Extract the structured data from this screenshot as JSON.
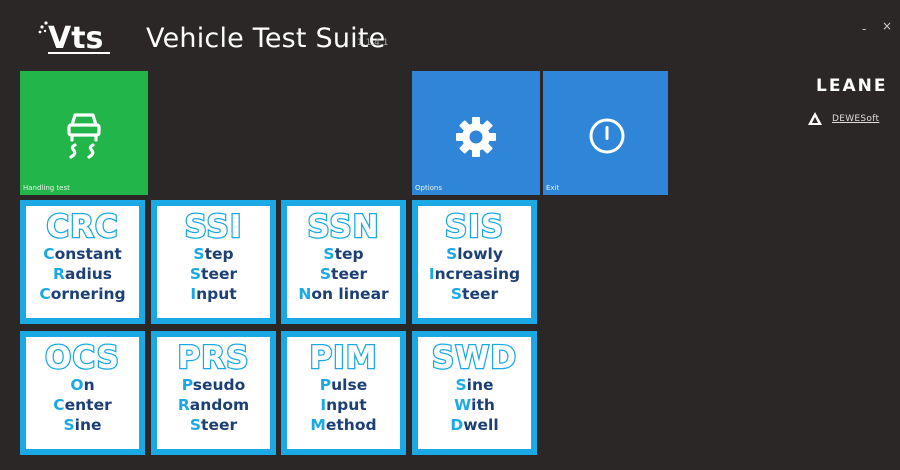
{
  "header": {
    "title": "Vehicle Test Suite",
    "version": "1.1.4.1",
    "logo_text": "Vts",
    "minimize_label": "-",
    "close_label": "×"
  },
  "brand": {
    "leane": "LEANE",
    "dewesoft": "DEWESoft"
  },
  "tiles": {
    "handling": {
      "label": "Handling test",
      "icon": "car-skid-icon",
      "color": "#22b54a"
    },
    "options": {
      "label": "Options",
      "icon": "gear-icon",
      "color": "#2f86d8"
    },
    "exit": {
      "label": "Exit",
      "icon": "power-icon",
      "color": "#2f86d8"
    }
  },
  "tests": [
    {
      "id": "crc",
      "abbr": "CRC",
      "lines": [
        {
          "initial": "C",
          "rest": "onstant"
        },
        {
          "initial": "R",
          "rest": "adius"
        },
        {
          "initial": "C",
          "rest": "ornering"
        }
      ]
    },
    {
      "id": "ssi",
      "abbr": "SSI",
      "lines": [
        {
          "initial": "S",
          "rest": "tep"
        },
        {
          "initial": "S",
          "rest": "teer"
        },
        {
          "initial": "I",
          "rest": "nput"
        }
      ]
    },
    {
      "id": "ssn",
      "abbr": "SSN",
      "lines": [
        {
          "initial": "S",
          "rest": "tep"
        },
        {
          "initial": "S",
          "rest": "teer"
        },
        {
          "initial": "N",
          "rest": "on linear"
        }
      ]
    },
    {
      "id": "sis",
      "abbr": "SIS",
      "lines": [
        {
          "initial": "S",
          "rest": "lowly"
        },
        {
          "initial": "I",
          "rest": "ncreasing"
        },
        {
          "initial": "S",
          "rest": "teer"
        }
      ]
    },
    {
      "id": "ocs",
      "abbr": "OCS",
      "lines": [
        {
          "initial": "O",
          "rest": "n"
        },
        {
          "initial": "C",
          "rest": "enter"
        },
        {
          "initial": "S",
          "rest": "ine"
        }
      ]
    },
    {
      "id": "prs",
      "abbr": "PRS",
      "lines": [
        {
          "initial": "P",
          "rest": "seudo"
        },
        {
          "initial": "R",
          "rest": "andom"
        },
        {
          "initial": "S",
          "rest": "teer"
        }
      ]
    },
    {
      "id": "pim",
      "abbr": "PIM",
      "lines": [
        {
          "initial": "P",
          "rest": "ulse"
        },
        {
          "initial": "I",
          "rest": "nput"
        },
        {
          "initial": "M",
          "rest": "ethod"
        }
      ]
    },
    {
      "id": "swd",
      "abbr": "SWD",
      "lines": [
        {
          "initial": "S",
          "rest": "ine"
        },
        {
          "initial": "W",
          "rest": "ith"
        },
        {
          "initial": "D",
          "rest": "well"
        }
      ]
    }
  ],
  "colors": {
    "background": "#2a2726",
    "test_accent": "#1aa9e4",
    "test_text": "#1c3f75"
  }
}
